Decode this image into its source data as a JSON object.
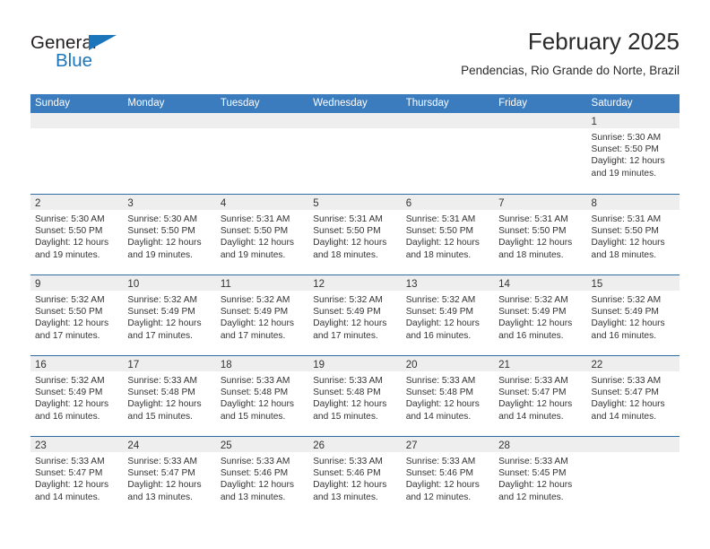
{
  "brand": {
    "word_one": "General",
    "word_two": "Blue",
    "logo_icon": "triangle-logo-icon",
    "accent_color": "#1b75bb"
  },
  "header": {
    "title": "February 2025",
    "subtitle": "Pendencias, Rio Grande do Norte, Brazil"
  },
  "calendar": {
    "header_color": "#3b7cbf",
    "band_color": "#eeeeee",
    "weekdays": [
      "Sunday",
      "Monday",
      "Tuesday",
      "Wednesday",
      "Thursday",
      "Friday",
      "Saturday"
    ],
    "weeks": [
      [
        {
          "day": "",
          "empty": true,
          "sunrise": "",
          "sunset": "",
          "daylight_1": "",
          "daylight_2": ""
        },
        {
          "day": "",
          "empty": true,
          "sunrise": "",
          "sunset": "",
          "daylight_1": "",
          "daylight_2": ""
        },
        {
          "day": "",
          "empty": true,
          "sunrise": "",
          "sunset": "",
          "daylight_1": "",
          "daylight_2": ""
        },
        {
          "day": "",
          "empty": true,
          "sunrise": "",
          "sunset": "",
          "daylight_1": "",
          "daylight_2": ""
        },
        {
          "day": "",
          "empty": true,
          "sunrise": "",
          "sunset": "",
          "daylight_1": "",
          "daylight_2": ""
        },
        {
          "day": "",
          "empty": true,
          "sunrise": "",
          "sunset": "",
          "daylight_1": "",
          "daylight_2": ""
        },
        {
          "day": "1",
          "empty": false,
          "sunrise": "Sunrise: 5:30 AM",
          "sunset": "Sunset: 5:50 PM",
          "daylight_1": "Daylight: 12 hours",
          "daylight_2": "and 19 minutes."
        }
      ],
      [
        {
          "day": "2",
          "empty": false,
          "sunrise": "Sunrise: 5:30 AM",
          "sunset": "Sunset: 5:50 PM",
          "daylight_1": "Daylight: 12 hours",
          "daylight_2": "and 19 minutes."
        },
        {
          "day": "3",
          "empty": false,
          "sunrise": "Sunrise: 5:30 AM",
          "sunset": "Sunset: 5:50 PM",
          "daylight_1": "Daylight: 12 hours",
          "daylight_2": "and 19 minutes."
        },
        {
          "day": "4",
          "empty": false,
          "sunrise": "Sunrise: 5:31 AM",
          "sunset": "Sunset: 5:50 PM",
          "daylight_1": "Daylight: 12 hours",
          "daylight_2": "and 19 minutes."
        },
        {
          "day": "5",
          "empty": false,
          "sunrise": "Sunrise: 5:31 AM",
          "sunset": "Sunset: 5:50 PM",
          "daylight_1": "Daylight: 12 hours",
          "daylight_2": "and 18 minutes."
        },
        {
          "day": "6",
          "empty": false,
          "sunrise": "Sunrise: 5:31 AM",
          "sunset": "Sunset: 5:50 PM",
          "daylight_1": "Daylight: 12 hours",
          "daylight_2": "and 18 minutes."
        },
        {
          "day": "7",
          "empty": false,
          "sunrise": "Sunrise: 5:31 AM",
          "sunset": "Sunset: 5:50 PM",
          "daylight_1": "Daylight: 12 hours",
          "daylight_2": "and 18 minutes."
        },
        {
          "day": "8",
          "empty": false,
          "sunrise": "Sunrise: 5:31 AM",
          "sunset": "Sunset: 5:50 PM",
          "daylight_1": "Daylight: 12 hours",
          "daylight_2": "and 18 minutes."
        }
      ],
      [
        {
          "day": "9",
          "empty": false,
          "sunrise": "Sunrise: 5:32 AM",
          "sunset": "Sunset: 5:50 PM",
          "daylight_1": "Daylight: 12 hours",
          "daylight_2": "and 17 minutes."
        },
        {
          "day": "10",
          "empty": false,
          "sunrise": "Sunrise: 5:32 AM",
          "sunset": "Sunset: 5:49 PM",
          "daylight_1": "Daylight: 12 hours",
          "daylight_2": "and 17 minutes."
        },
        {
          "day": "11",
          "empty": false,
          "sunrise": "Sunrise: 5:32 AM",
          "sunset": "Sunset: 5:49 PM",
          "daylight_1": "Daylight: 12 hours",
          "daylight_2": "and 17 minutes."
        },
        {
          "day": "12",
          "empty": false,
          "sunrise": "Sunrise: 5:32 AM",
          "sunset": "Sunset: 5:49 PM",
          "daylight_1": "Daylight: 12 hours",
          "daylight_2": "and 17 minutes."
        },
        {
          "day": "13",
          "empty": false,
          "sunrise": "Sunrise: 5:32 AM",
          "sunset": "Sunset: 5:49 PM",
          "daylight_1": "Daylight: 12 hours",
          "daylight_2": "and 16 minutes."
        },
        {
          "day": "14",
          "empty": false,
          "sunrise": "Sunrise: 5:32 AM",
          "sunset": "Sunset: 5:49 PM",
          "daylight_1": "Daylight: 12 hours",
          "daylight_2": "and 16 minutes."
        },
        {
          "day": "15",
          "empty": false,
          "sunrise": "Sunrise: 5:32 AM",
          "sunset": "Sunset: 5:49 PM",
          "daylight_1": "Daylight: 12 hours",
          "daylight_2": "and 16 minutes."
        }
      ],
      [
        {
          "day": "16",
          "empty": false,
          "sunrise": "Sunrise: 5:32 AM",
          "sunset": "Sunset: 5:49 PM",
          "daylight_1": "Daylight: 12 hours",
          "daylight_2": "and 16 minutes."
        },
        {
          "day": "17",
          "empty": false,
          "sunrise": "Sunrise: 5:33 AM",
          "sunset": "Sunset: 5:48 PM",
          "daylight_1": "Daylight: 12 hours",
          "daylight_2": "and 15 minutes."
        },
        {
          "day": "18",
          "empty": false,
          "sunrise": "Sunrise: 5:33 AM",
          "sunset": "Sunset: 5:48 PM",
          "daylight_1": "Daylight: 12 hours",
          "daylight_2": "and 15 minutes."
        },
        {
          "day": "19",
          "empty": false,
          "sunrise": "Sunrise: 5:33 AM",
          "sunset": "Sunset: 5:48 PM",
          "daylight_1": "Daylight: 12 hours",
          "daylight_2": "and 15 minutes."
        },
        {
          "day": "20",
          "empty": false,
          "sunrise": "Sunrise: 5:33 AM",
          "sunset": "Sunset: 5:48 PM",
          "daylight_1": "Daylight: 12 hours",
          "daylight_2": "and 14 minutes."
        },
        {
          "day": "21",
          "empty": false,
          "sunrise": "Sunrise: 5:33 AM",
          "sunset": "Sunset: 5:47 PM",
          "daylight_1": "Daylight: 12 hours",
          "daylight_2": "and 14 minutes."
        },
        {
          "day": "22",
          "empty": false,
          "sunrise": "Sunrise: 5:33 AM",
          "sunset": "Sunset: 5:47 PM",
          "daylight_1": "Daylight: 12 hours",
          "daylight_2": "and 14 minutes."
        }
      ],
      [
        {
          "day": "23",
          "empty": false,
          "sunrise": "Sunrise: 5:33 AM",
          "sunset": "Sunset: 5:47 PM",
          "daylight_1": "Daylight: 12 hours",
          "daylight_2": "and 14 minutes."
        },
        {
          "day": "24",
          "empty": false,
          "sunrise": "Sunrise: 5:33 AM",
          "sunset": "Sunset: 5:47 PM",
          "daylight_1": "Daylight: 12 hours",
          "daylight_2": "and 13 minutes."
        },
        {
          "day": "25",
          "empty": false,
          "sunrise": "Sunrise: 5:33 AM",
          "sunset": "Sunset: 5:46 PM",
          "daylight_1": "Daylight: 12 hours",
          "daylight_2": "and 13 minutes."
        },
        {
          "day": "26",
          "empty": false,
          "sunrise": "Sunrise: 5:33 AM",
          "sunset": "Sunset: 5:46 PM",
          "daylight_1": "Daylight: 12 hours",
          "daylight_2": "and 13 minutes."
        },
        {
          "day": "27",
          "empty": false,
          "sunrise": "Sunrise: 5:33 AM",
          "sunset": "Sunset: 5:46 PM",
          "daylight_1": "Daylight: 12 hours",
          "daylight_2": "and 12 minutes."
        },
        {
          "day": "28",
          "empty": false,
          "sunrise": "Sunrise: 5:33 AM",
          "sunset": "Sunset: 5:45 PM",
          "daylight_1": "Daylight: 12 hours",
          "daylight_2": "and 12 minutes."
        },
        {
          "day": "",
          "empty": true,
          "sunrise": "",
          "sunset": "",
          "daylight_1": "",
          "daylight_2": ""
        }
      ]
    ]
  }
}
